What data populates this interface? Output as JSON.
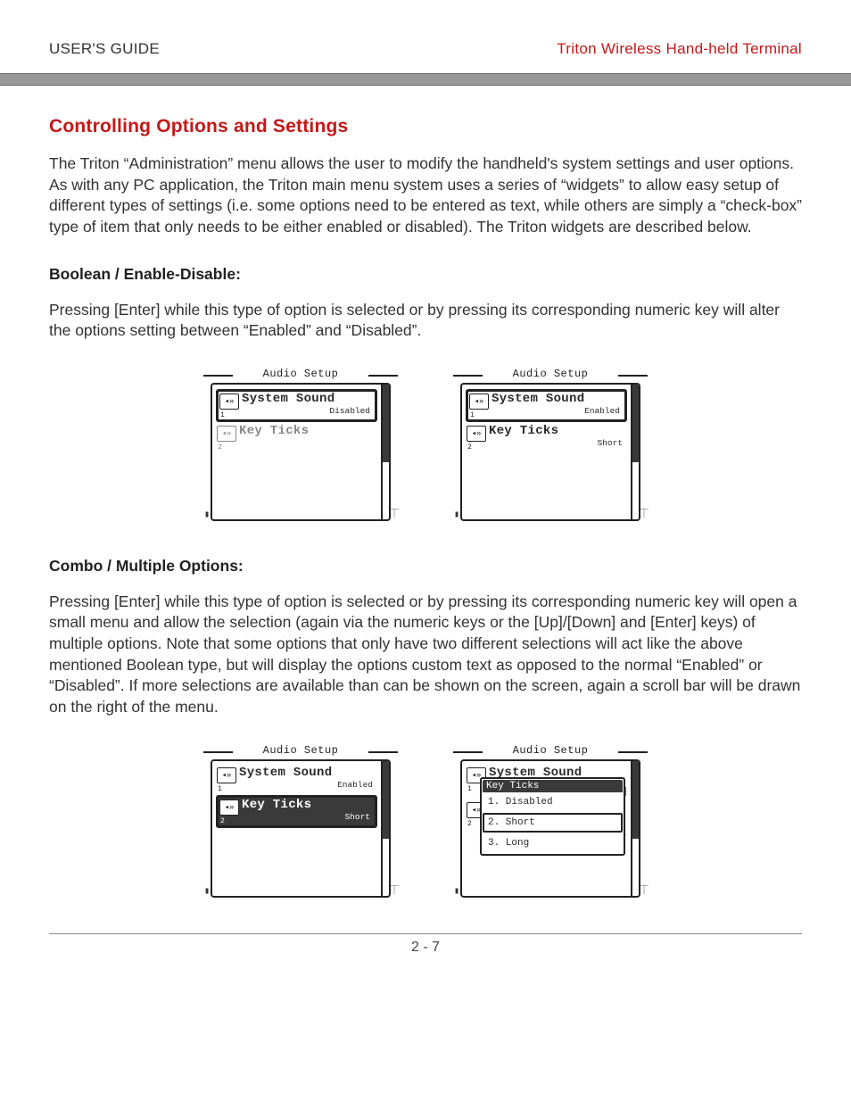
{
  "header": {
    "left": "USER'S GUIDE",
    "right": "Triton Wireless Hand-held Terminal"
  },
  "section_title": "Controlling Options and Settings",
  "intro_para": "The Triton “Administration” menu allows the user to modify the handheld's system settings and user options. As with any PC application, the Triton main menu system uses a series of “widgets” to allow easy setup of different types of settings (i.e. some options need to be entered as text, while others are simply a “check-box” type of item that only needs to be either enabled or disabled). The Triton widgets are described below.",
  "boolean": {
    "heading": "Boolean / Enable-Disable:",
    "para": "Pressing [Enter] while this type of option is selected or by pressing its corresponding numeric key will alter the options setting between “Enabled” and “Disabled”."
  },
  "combo": {
    "heading": "Combo / Multiple Options:",
    "para": "Pressing [Enter] while this type of option is selected or by pressing its corresponding numeric key will open a small menu and allow the selection (again via the numeric keys or the [Up]/[Down] and [Enter] keys) of multiple options. Note that some options that only have two different selections will act like the above mentioned Boolean type, but will display the options custom text as opposed to the normal “Enabled” or “Disabled”. If more selections are available than can be shown on the screen, again a scroll bar will be drawn on the right of the menu."
  },
  "dev_title": "Audio Setup",
  "opts": {
    "sys_sound": "System Sound",
    "key_ticks": "Key Ticks",
    "disabled": "Disabled",
    "enabled": "Enabled",
    "short": "Short",
    "popup_title": "Key Ticks",
    "p1": "1. Disabled",
    "p2": "2. Short",
    "p3": "3. Long",
    "n1": "1",
    "n2": "2",
    "d_hint": "d",
    "t_hint": "t"
  },
  "icon_glyph": "◂»",
  "page_number": "2 - 7"
}
